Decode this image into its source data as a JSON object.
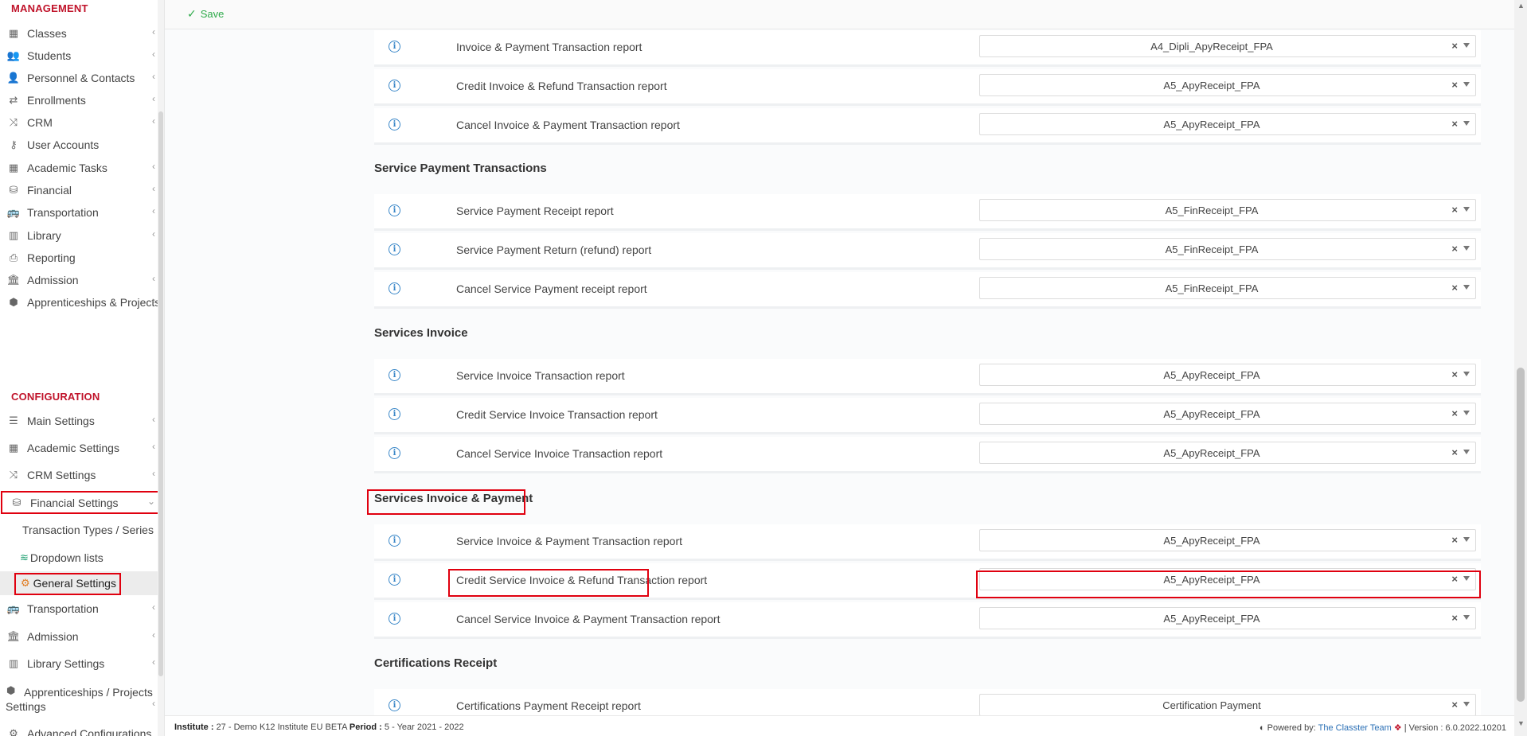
{
  "sidebar": {
    "management_title": "MANAGEMENT",
    "management_items": [
      {
        "label": "Classes",
        "icon": "classes-icon"
      },
      {
        "label": "Students",
        "icon": "students-icon"
      },
      {
        "label": "Personnel & Contacts",
        "icon": "personnel-icon"
      },
      {
        "label": "Enrollments",
        "icon": "enrollments-icon"
      },
      {
        "label": "CRM",
        "icon": "crm-icon"
      },
      {
        "label": "User Accounts",
        "icon": "key-icon"
      },
      {
        "label": "Academic Tasks",
        "icon": "tasks-icon"
      },
      {
        "label": "Financial",
        "icon": "coins-icon"
      },
      {
        "label": "Transportation",
        "icon": "bus-icon"
      },
      {
        "label": "Library",
        "icon": "library-icon"
      },
      {
        "label": "Reporting",
        "icon": "printer-icon"
      },
      {
        "label": "Admission",
        "icon": "institution-icon"
      },
      {
        "label": "Apprenticeships & Projects",
        "icon": "cube-icon"
      }
    ],
    "configuration_title": "CONFIGURATION",
    "configuration_items": [
      {
        "label": "Main Settings",
        "icon": "sliders-icon"
      },
      {
        "label": "Academic Settings",
        "icon": "classes-icon"
      },
      {
        "label": "CRM Settings",
        "icon": "crm-icon"
      },
      {
        "label": "Financial Settings",
        "icon": "coins-icon"
      }
    ],
    "financial_sub_items": [
      {
        "label": "Transaction Types / Series"
      },
      {
        "label": "Dropdown lists",
        "icon": "layers-icon"
      },
      {
        "label": "General Settings",
        "icon": "gear-icon"
      }
    ],
    "after_items": [
      {
        "label": "Transportation",
        "icon": "bus-icon"
      },
      {
        "label": "Admission",
        "icon": "institution-icon"
      },
      {
        "label": "Library Settings",
        "icon": "library-icon"
      }
    ],
    "apprenticeships_settings": {
      "line1": "Apprenticeships / Projects",
      "line2": "Settings"
    },
    "advanced": "Advanced Configurations"
  },
  "toolbar": {
    "save_label": "Save"
  },
  "groups": {
    "invoice_payment_rows": [
      {
        "label": "Invoice & Payment Transaction report",
        "value": "A4_Dipli_ApyReceipt_FPA"
      },
      {
        "label": "Credit Invoice & Refund Transaction report",
        "value": "A5_ApyReceipt_FPA"
      },
      {
        "label": "Cancel Invoice & Payment Transaction report",
        "value": "A5_ApyReceipt_FPA"
      }
    ],
    "service_payment": {
      "title": "Service Payment Transactions",
      "rows": [
        {
          "label": "Service Payment Receipt report",
          "value": "A5_FinReceipt_FPA"
        },
        {
          "label": "Service Payment Return (refund) report",
          "value": "A5_FinReceipt_FPA"
        },
        {
          "label": "Cancel Service Payment receipt report",
          "value": "A5_FinReceipt_FPA"
        }
      ]
    },
    "services_invoice": {
      "title": "Services Invoice",
      "rows": [
        {
          "label": "Service Invoice Transaction report",
          "value": "A5_ApyReceipt_FPA"
        },
        {
          "label": "Credit Service Invoice Transaction report",
          "value": "A5_ApyReceipt_FPA"
        },
        {
          "label": "Cancel Service Invoice Transaction report",
          "value": "A5_ApyReceipt_FPA"
        }
      ]
    },
    "services_invoice_payment": {
      "title": "Services Invoice & Payment",
      "rows": [
        {
          "label": "Service Invoice & Payment Transaction report",
          "value": "A5_ApyReceipt_FPA"
        },
        {
          "label": "Credit Service Invoice & Refund Transaction report",
          "value": "A5_ApyReceipt_FPA"
        },
        {
          "label": "Cancel Service Invoice & Payment Transaction report",
          "value": "A5_ApyReceipt_FPA"
        }
      ]
    },
    "certifications": {
      "title": "Certifications Receipt",
      "rows": [
        {
          "label": "Certifications Payment Receipt report",
          "value": "Certification Payment"
        }
      ]
    }
  },
  "footer": {
    "institute_label": "Institute :",
    "institute_value": "27 - Demo K12 Institute EU BETA",
    "period_label": "Period :",
    "period_value": "5 - Year 2021 - 2022",
    "powered_label": "Powered by:",
    "powered_link": "The Classter Team",
    "version_label": "| Version :",
    "version_value": "6.0.2022.10201"
  },
  "colors": {
    "accent_red": "#c0132a",
    "highlight": "#e0000f",
    "save_green": "#2eaa4a",
    "info_blue": "#3a87c8"
  }
}
